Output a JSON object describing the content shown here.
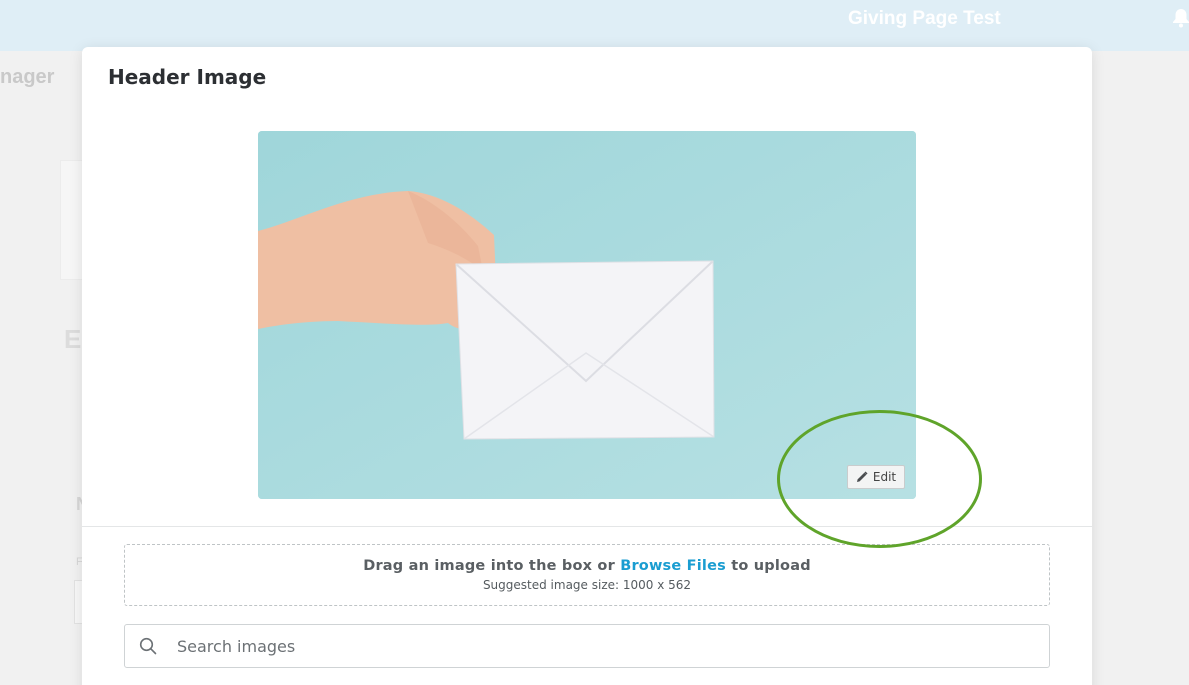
{
  "background": {
    "topbar_title": "Giving Page Test",
    "sidebar_heading": "nager",
    "fragment_heading": "E",
    "fragment_label": "N",
    "fragment_small": "F"
  },
  "modal": {
    "title": "Header Image",
    "edit_button_label": "Edit",
    "dropzone": {
      "text_before": "Drag an image into the box or ",
      "browse_link": "Browse Files",
      "text_after": " to upload",
      "suggested_size": "Suggested image size: 1000 x 562"
    },
    "search": {
      "placeholder": "Search images",
      "value": ""
    }
  },
  "colors": {
    "accent_link": "#1a9dd1",
    "highlight_ring": "#5fa42a",
    "image_background": "#acdcdf"
  },
  "icons": {
    "edit": "pencil-icon",
    "search": "search-icon",
    "notifications": "bell-icon"
  }
}
